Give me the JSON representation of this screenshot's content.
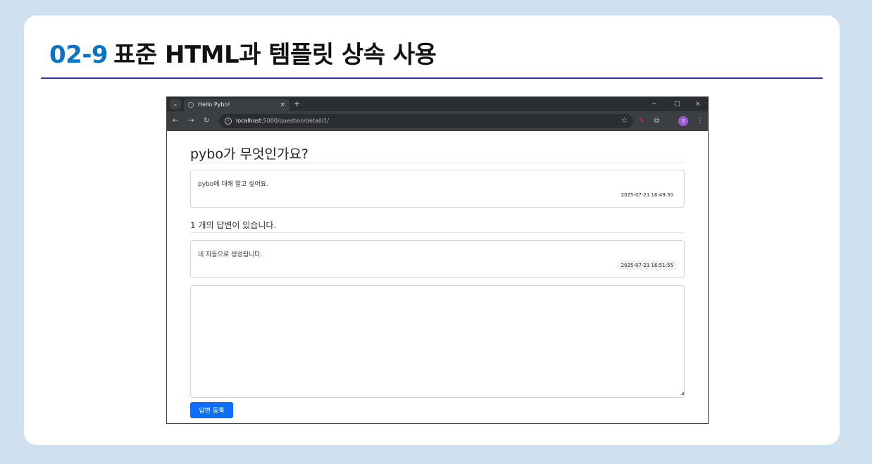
{
  "slide": {
    "number": "02-9",
    "title": "표준 HTML과 템플릿 상속 사용"
  },
  "browser": {
    "tab_title": "Hello Pybo!",
    "tab_close": "×",
    "new_tab": "+",
    "window_controls": {
      "minimize": "−",
      "maximize": "□",
      "close": "×"
    },
    "url_host": "localhost",
    "url_path": ":5000/question/detail/1/",
    "profile_initial": "S"
  },
  "question": {
    "subject": "pybo가 무엇인가요?",
    "content": "pybo에 대해 알고 싶어요.",
    "create_date": "2025-07-21 16:49:50"
  },
  "answers_header": "1 개의 답변이 있습니다.",
  "answers": [
    {
      "content": "네 자동으로 생성됩니다.",
      "create_date": "2025-07-21 16:51:55"
    }
  ],
  "answer_form": {
    "content_value": "",
    "submit_label": "답변 등록"
  },
  "colors": {
    "accent": "#0b73c4",
    "button": "#0d6efd",
    "rule": "#2d3aa0"
  }
}
